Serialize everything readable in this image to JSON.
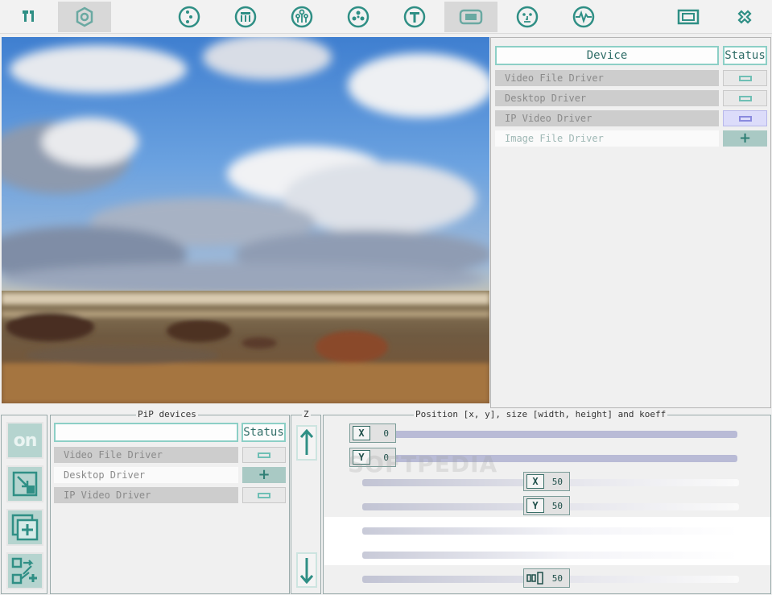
{
  "toolbar": {
    "icons": [
      "antenna-icon",
      "gear-icon",
      "dots-icon",
      "store-icon",
      "tree-icon",
      "pad-icon",
      "text-icon",
      "screen-icon",
      "face-icon",
      "pulse-icon",
      "window-icon",
      "close-icon"
    ]
  },
  "devices": {
    "header_device": "Device",
    "header_status": "Status",
    "rows": [
      {
        "label": "Video File Driver",
        "status": "minus"
      },
      {
        "label": "Desktop Driver",
        "status": "minus"
      },
      {
        "label": "IP Video Driver",
        "status": "minus-active"
      },
      {
        "label": "Image File Driver",
        "status": "plus"
      }
    ]
  },
  "side_buttons": {
    "on_label": "on"
  },
  "pip": {
    "title": "PiP devices",
    "header_status": "Status",
    "rows": [
      {
        "label": "Video File Driver",
        "status": "minus"
      },
      {
        "label": "Desktop Driver",
        "status": "plus"
      },
      {
        "label": "IP Video Driver",
        "status": "minus"
      }
    ]
  },
  "z": {
    "title": "Z"
  },
  "position": {
    "title": "Position [x, y], size [width, height] and koeff",
    "x_value": "0",
    "y_value": "0",
    "width_value": "50",
    "height_value": "50",
    "koeff_value": "50"
  },
  "watermark": "SOFTPEDIA",
  "colors": {
    "accent": "#2f8f85",
    "accent_light": "#8ccfc6",
    "button_bg": "#b5d4cf"
  }
}
